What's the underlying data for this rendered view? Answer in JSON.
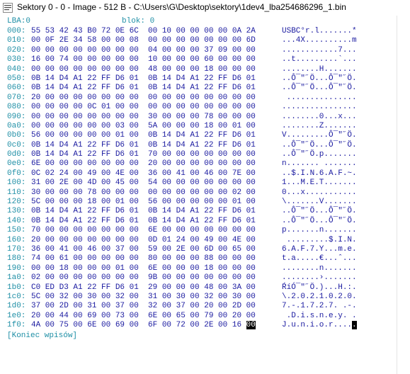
{
  "window": {
    "title": "Sektory 0 - 0 - Image - 512 B - C:\\Users\\G\\Desktop\\sektory\\1dev4_lba254686296_1.bin"
  },
  "header": {
    "lba_label": "LBA:0",
    "block_label": "blok: 0"
  },
  "rows": [
    {
      "addr": "000:",
      "hex": "55 53 42 43 B0 72 0E 6C  00 10 00 00 00 00 0A 2A",
      "ascii": "USBC°r.l.......*"
    },
    {
      "addr": "010:",
      "hex": "00 0F 2E 34 58 00 00 08  00 00 00 00 00 00 00 6D",
      "ascii": "...4X..........m"
    },
    {
      "addr": "020:",
      "hex": "00 00 00 00 00 00 00 00  04 00 00 00 37 09 00 00",
      "ascii": "............7..."
    },
    {
      "addr": "030:",
      "hex": "16 00 74 00 00 00 00 00  10 00 00 00 60 00 00 00",
      "ascii": "..t.........`..."
    },
    {
      "addr": "040:",
      "hex": "00 00 00 00 00 00 00 00  48 00 00 00 18 00 00 00",
      "ascii": "........H......."
    },
    {
      "addr": "050:",
      "hex": "0B 14 D4 A1 22 FF D6 01  0B 14 D4 A1 22 FF D6 01",
      "ascii": "..Ô¯\"˝Ö...Ô¯\"˝Ö."
    },
    {
      "addr": "060:",
      "hex": "0B 14 D4 A1 22 FF D6 01  0B 14 D4 A1 22 FF D6 01",
      "ascii": "..Ô¯\"˝Ö...Ô¯\"˝Ö."
    },
    {
      "addr": "070:",
      "hex": "20 00 00 00 00 00 00 00  00 00 00 00 00 00 00 00",
      "ascii": " ..............."
    },
    {
      "addr": "080:",
      "hex": "00 00 00 00 0C 01 00 00  00 00 00 00 00 00 00 00",
      "ascii": "................"
    },
    {
      "addr": "090:",
      "hex": "00 00 00 00 00 00 00 00  30 00 00 00 78 00 00 00",
      "ascii": "........0...x..."
    },
    {
      "addr": "0a0:",
      "hex": "00 00 00 00 00 00 03 00  5A 00 00 00 18 00 01 00",
      "ascii": "........Z......."
    },
    {
      "addr": "0b0:",
      "hex": "56 00 00 00 00 00 01 00  0B 14 D4 A1 22 FF D6 01",
      "ascii": "V.........Ô¯\"˝Ö."
    },
    {
      "addr": "0c0:",
      "hex": "0B 14 D4 A1 22 FF D6 01  0B 14 D4 A1 22 FF D6 01",
      "ascii": "..Ô¯\"˝Ö...Ô¯\"˝Ö."
    },
    {
      "addr": "0d0:",
      "hex": "0B 14 D4 A1 22 FF D6 01  70 00 00 00 00 00 00 00",
      "ascii": "..Ô¯\"˝Ö.p......."
    },
    {
      "addr": "0e0:",
      "hex": "6E 00 00 00 00 00 00 00  20 00 00 00 00 00 00 00",
      "ascii": "n....... ......."
    },
    {
      "addr": "0f0:",
      "hex": "0C 02 24 00 49 00 4E 00  36 00 41 00 46 00 7E 00",
      "ascii": "..$.I.N.6.A.F.~."
    },
    {
      "addr": "100:",
      "hex": "31 00 2E 00 4D 00 45 00  54 00 00 00 00 00 00 00",
      "ascii": "1...M.E.T......."
    },
    {
      "addr": "110:",
      "hex": "30 00 00 00 78 00 00 00  00 00 00 00 00 00 02 00",
      "ascii": "0...x..........."
    },
    {
      "addr": "120:",
      "hex": "5C 00 00 00 18 00 01 00  56 00 00 00 00 00 01 00",
      "ascii": "\\.......V......."
    },
    {
      "addr": "130:",
      "hex": "0B 14 D4 A1 22 FF D6 01  0B 14 D4 A1 22 FF D6 01",
      "ascii": "..Ô¯\"˝Ö...Ô¯\"˝Ö."
    },
    {
      "addr": "140:",
      "hex": "0B 14 D4 A1 22 FF D6 01  0B 14 D4 A1 22 FF D6 01",
      "ascii": "..Ô¯\"˝Ö...Ô¯\"˝Ö."
    },
    {
      "addr": "150:",
      "hex": "70 00 00 00 00 00 00 00  6E 00 00 00 00 00 00 00",
      "ascii": "p.......n......."
    },
    {
      "addr": "160:",
      "hex": "20 00 00 00 00 00 00 00  0D 01 24 00 49 00 4E 00",
      "ascii": " .........$.I.N."
    },
    {
      "addr": "170:",
      "hex": "36 00 41 00 46 00 37 00  59 00 2E 00 6D 00 65 00",
      "ascii": "6.A.F.7.Y...m.e."
    },
    {
      "addr": "180:",
      "hex": "74 00 61 00 00 00 00 00  80 00 00 00 88 00 00 00",
      "ascii": "t.a.....€...ˆ..."
    },
    {
      "addr": "190:",
      "hex": "00 00 18 00 00 00 01 00  6E 00 00 00 18 00 00 00",
      "ascii": "........n......."
    },
    {
      "addr": "1a0:",
      "hex": "02 00 00 00 00 00 00 00  9B 00 00 00 00 00 00 00",
      "ascii": "........›......."
    },
    {
      "addr": "1b0:",
      "hex": "C0 ED D3 A1 22 FF D6 01  29 00 00 00 48 00 3A 00",
      "ascii": "ŔíÓ¯\"˝Ö.)...H.:."
    },
    {
      "addr": "1c0:",
      "hex": "5C 00 32 00 30 00 32 00  31 00 30 00 32 00 30 00",
      "ascii": "\\.2.0.2.1.0.2.0."
    },
    {
      "addr": "1d0:",
      "hex": "37 00 2D 00 31 00 37 00  32 00 37 00 20 00 2D 00",
      "ascii": "7.-.1.7.2.7. .-."
    },
    {
      "addr": "1e0:",
      "hex": "20 00 44 00 69 00 73 00  6E 00 65 00 79 00 20 00",
      "ascii": " .D.i.s.n.e.y. ."
    },
    {
      "addr": "1f0:",
      "hex": "4A 00 75 00 6E 00 69 00  6F 00 72 00 2E 00 16 ",
      "hex_selected": "00",
      "ascii": "J.u.n.i.o.r....",
      "ascii_selected": "."
    }
  ],
  "footer": {
    "text": "[Koniec wpisów]"
  }
}
